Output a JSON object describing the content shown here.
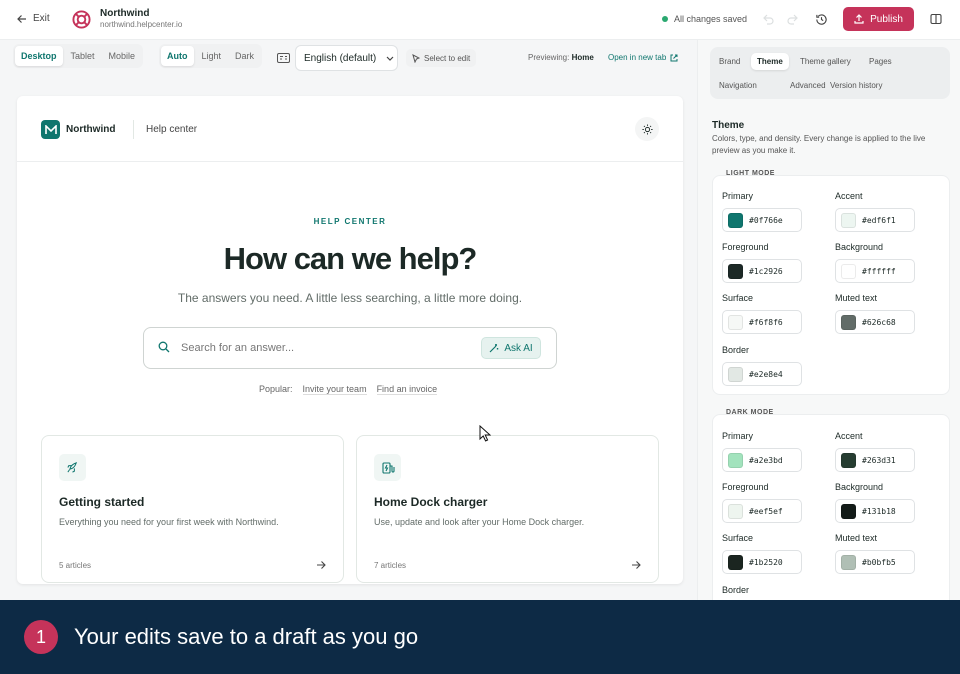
{
  "topbar": {
    "exit_label": "Exit",
    "brand_name": "Northwind",
    "brand_url": "northwind.helpcenter.io",
    "save_status": "All changes saved",
    "publish_label": "Publish"
  },
  "toolbar": {
    "devices": [
      "Desktop",
      "Tablet",
      "Mobile"
    ],
    "active_device": "Desktop",
    "modes": [
      "Auto",
      "Light",
      "Dark"
    ],
    "active_mode": "Auto",
    "language": "English (default)",
    "select_to_edit": "Select to edit",
    "previewing_label": "Previewing:",
    "previewing_page": "Home",
    "open_new_tab": "Open in new tab"
  },
  "site": {
    "brand_name": "Northwind",
    "nav_label": "Help center",
    "eyebrow": "HELP CENTER",
    "hero_title": "How can we help?",
    "hero_subtitle": "The answers you need. A little less searching, a little more doing.",
    "search_placeholder": "Search for an answer...",
    "ask_ai_label": "Ask AI",
    "popular_label": "Popular:",
    "popular_links": [
      "Invite your team",
      "Find an invoice"
    ],
    "cards": [
      {
        "title": "Getting started",
        "description": "Everything you need for your first week with Northwind.",
        "count": "5 articles",
        "icon": "rocket-icon"
      },
      {
        "title": "Home Dock charger",
        "description": "Use, update and look after your Home Dock charger.",
        "count": "7 articles",
        "icon": "ev-charger-icon"
      }
    ]
  },
  "panel": {
    "tabs": [
      "Brand",
      "Theme",
      "Theme gallery",
      "Pages",
      "Navigation",
      "Advanced",
      "Version history"
    ],
    "active_tab": "Theme",
    "title": "Theme",
    "description": "Colors, type, and density. Every change is applied to the live preview as you make it.",
    "light_mode": {
      "heading": "LIGHT MODE",
      "colors": [
        {
          "label": "Primary",
          "value": "#0f766e"
        },
        {
          "label": "Accent",
          "value": "#edf6f1"
        },
        {
          "label": "Foreground",
          "value": "#1c2926"
        },
        {
          "label": "Background",
          "value": "#ffffff"
        },
        {
          "label": "Surface",
          "value": "#f6f8f6"
        },
        {
          "label": "Muted text",
          "value": "#626c68"
        },
        {
          "label": "Border",
          "value": "#e2e8e4"
        }
      ]
    },
    "dark_mode": {
      "heading": "DARK MODE",
      "colors": [
        {
          "label": "Primary",
          "value": "#a2e3bd"
        },
        {
          "label": "Accent",
          "value": "#263d31"
        },
        {
          "label": "Foreground",
          "value": "#eef5ef"
        },
        {
          "label": "Background",
          "value": "#131b18"
        },
        {
          "label": "Surface",
          "value": "#1b2520"
        },
        {
          "label": "Muted text",
          "value": "#b0bfb5"
        },
        {
          "label": "Border",
          "value": ""
        }
      ]
    }
  },
  "banner": {
    "step": "1",
    "text": "Your edits save to a draft as you go"
  }
}
